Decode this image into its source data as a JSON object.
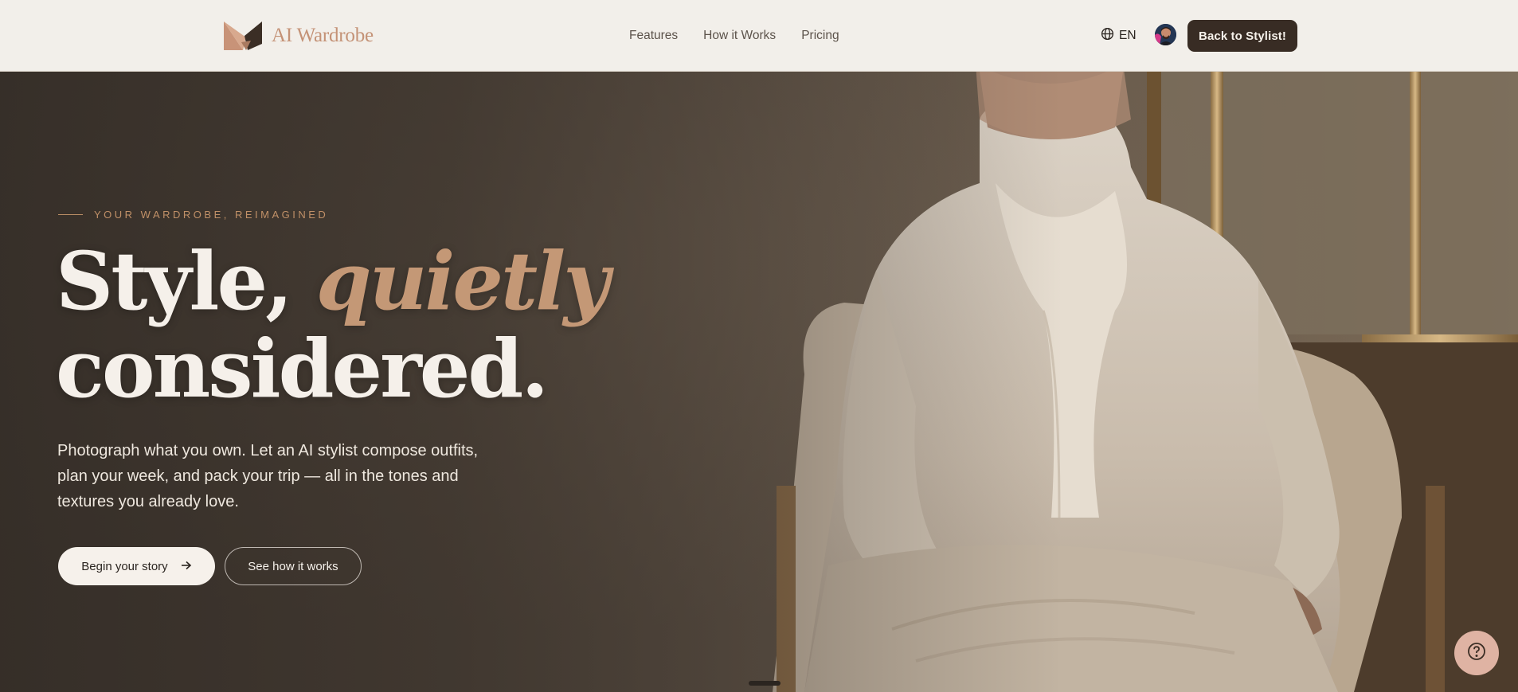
{
  "header": {
    "logo_text": "AI Wardrobe",
    "nav": [
      {
        "label": "Features"
      },
      {
        "label": "How it Works"
      },
      {
        "label": "Pricing"
      }
    ],
    "language": "EN",
    "cta_label": "Back to Stylist!"
  },
  "hero": {
    "eyebrow": "Your wardrobe, reimagined",
    "headline_line1": "Style,",
    "headline_accent": "quietly",
    "headline_line2": "considered.",
    "description": "Photograph what you own. Let an AI stylist compose outfits, plan your week, and pack your trip — all in the tones and textures you already love.",
    "primary_button": "Begin your story",
    "secondary_button": "See how it works"
  },
  "colors": {
    "header_bg": "#f2efea",
    "accent": "#c49876",
    "cta_bg": "#382c24",
    "help_bg": "#dfb3a3"
  },
  "icons": {
    "logo": "logo-icon",
    "language": "globe-icon",
    "arrow": "arrow-right-icon",
    "help": "help-icon"
  }
}
